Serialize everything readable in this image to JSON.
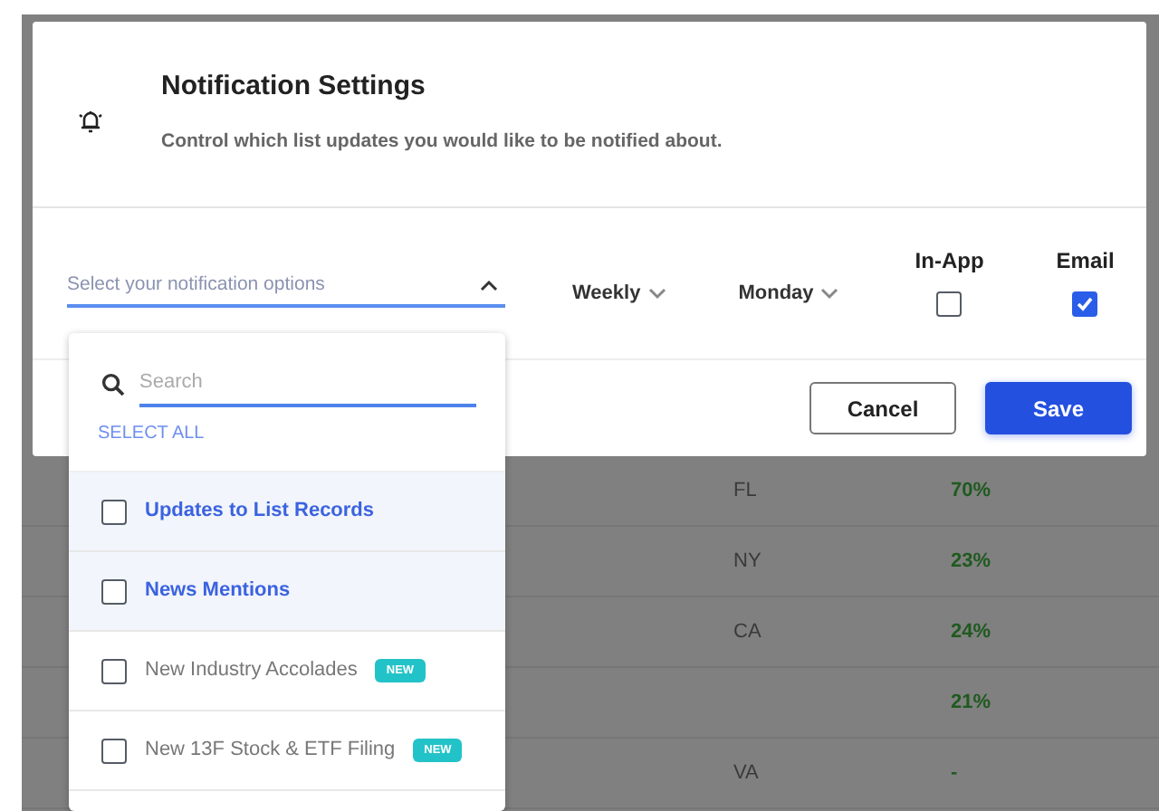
{
  "dialog": {
    "title": "Notification Settings",
    "subtitle": "Control which list updates you would like to be notified about.",
    "select": {
      "placeholder": "Select your notification options",
      "expanded": true
    },
    "frequency": "Weekly",
    "day": "Monday",
    "channels": [
      {
        "label": "In-App",
        "checked": false
      },
      {
        "label": "Email",
        "checked": true
      }
    ],
    "buttons": [
      {
        "label": "Cancel",
        "kind": "secondary"
      },
      {
        "label": "Save",
        "kind": "primary"
      }
    ]
  },
  "dropdown": {
    "search": {
      "placeholder": "Search"
    },
    "select_all": "SELECT ALL",
    "options": [
      {
        "label": "Updates to List Records",
        "checked": false,
        "highlighted": true
      },
      {
        "label": "News Mentions",
        "checked": false,
        "highlighted": true
      },
      {
        "label": "New Industry Accolades",
        "checked": false,
        "highlighted": false,
        "badge": "NEW"
      },
      {
        "label": "New 13F Stock & ETF Filing",
        "checked": false,
        "highlighted": false,
        "badge": "NEW"
      }
    ]
  },
  "table": {
    "rows": [
      {
        "state": "FL",
        "percent": "70%"
      },
      {
        "state": "NY",
        "percent": "23%"
      },
      {
        "state": "CA",
        "percent": "24%"
      },
      {
        "state": "",
        "percent": "21%"
      },
      {
        "state": "VA",
        "percent": "-"
      }
    ]
  }
}
